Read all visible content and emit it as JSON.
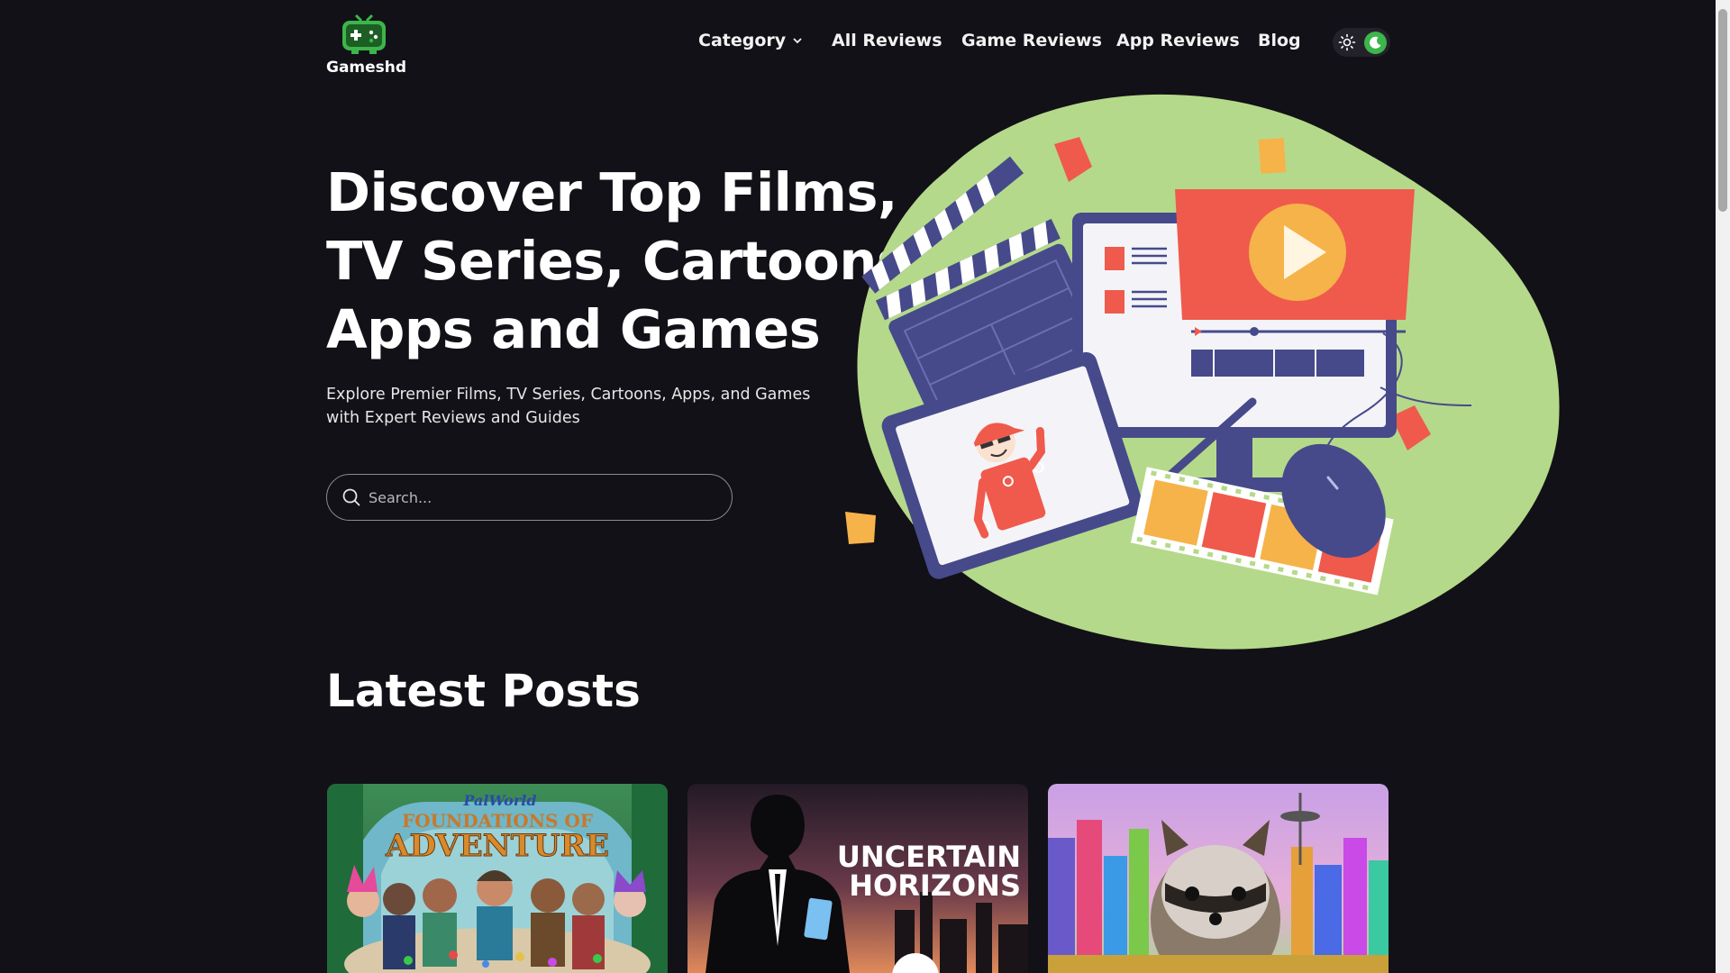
{
  "header": {
    "logo_text": "Gameshd",
    "nav": [
      {
        "label": "Category",
        "has_dropdown": true
      },
      {
        "label": "All Reviews"
      },
      {
        "label": "Game Reviews"
      },
      {
        "label": "App Reviews"
      },
      {
        "label": "Blog"
      }
    ],
    "theme": "dark"
  },
  "hero": {
    "title_lines": [
      "Discover Top Films,",
      "TV Series, Cartoons,",
      "Apps and Games"
    ],
    "subtitle_lines": [
      "Explore Premier Films, TV Series, Cartoons, Apps, and Games",
      "with Expert Reviews and Guides"
    ],
    "search_placeholder": "Search..."
  },
  "latest": {
    "title": "Latest Posts",
    "cards": [
      {
        "image_text_1": "PalWorld",
        "image_text_2": "FOUNDATIONS OF",
        "image_text_3": "ADVENTURE"
      },
      {
        "image_text_1": "UNCERTAIN",
        "image_text_2": "HORIZONS"
      },
      {
        "image_text_1": ""
      }
    ]
  },
  "colors": {
    "background": "#121117",
    "accent_green": "#3cb54a",
    "blob": "#b5d98a",
    "illustration_red": "#ef5a4c",
    "illustration_navy": "#464a8a"
  }
}
